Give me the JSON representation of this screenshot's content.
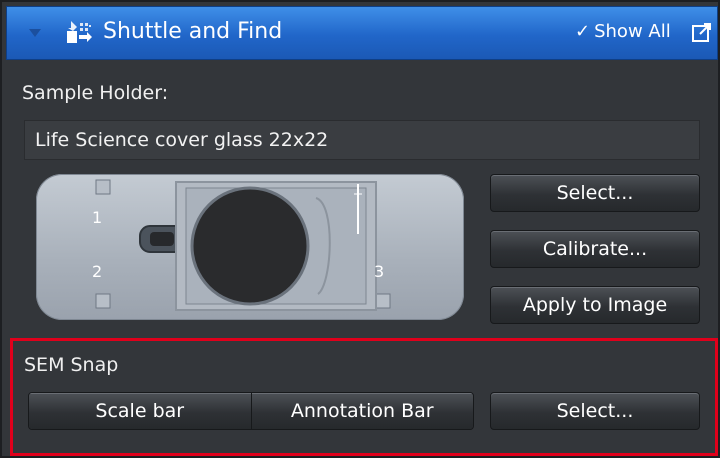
{
  "panel": {
    "title": "Shuttle and Find",
    "show_all_label": "Show All",
    "icons": {
      "collapse": "chevron-down-icon",
      "tool": "shuttle-find-icon",
      "show_all_check": "checkmark-icon",
      "popout": "popout-icon"
    },
    "colors": {
      "titlebar": "#2166c9",
      "highlight_box": "#e0001b",
      "background": "#33363a"
    }
  },
  "sample_holder": {
    "label": "Sample Holder:",
    "value": "Life Science cover glass 22x22",
    "marks": [
      "1",
      "2",
      "3"
    ],
    "buttons": {
      "select": "Select...",
      "calibrate": "Calibrate...",
      "apply": "Apply to Image"
    }
  },
  "sem_snap": {
    "label": "SEM Snap",
    "scale_bar": "Scale bar",
    "annotation_bar": "Annotation Bar",
    "select": "Select..."
  }
}
